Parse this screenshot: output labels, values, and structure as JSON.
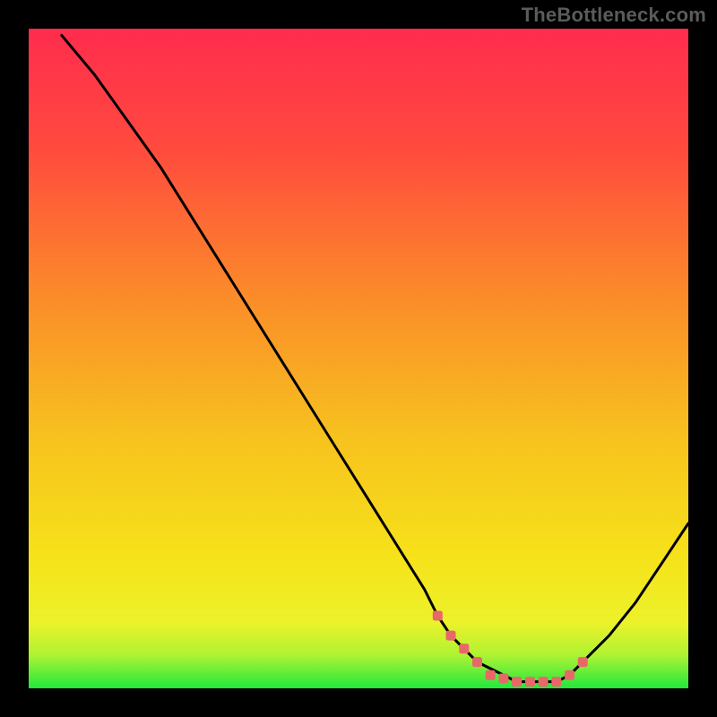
{
  "watermark": "TheBottleneck.com",
  "chart_data": {
    "type": "line",
    "title": "",
    "xlabel": "",
    "ylabel": "",
    "xlim": [
      0,
      100
    ],
    "ylim": [
      0,
      100
    ],
    "grid": false,
    "legend": "none",
    "background_gradient": {
      "top": "#ff2c4e",
      "mid": "#f6cf1d",
      "green_band": "#20e83c",
      "bottom": "#20e83c"
    },
    "series": [
      {
        "name": "bottleneck-curve",
        "type": "line",
        "color": "#000000",
        "x": [
          5,
          10,
          15,
          20,
          25,
          30,
          35,
          40,
          45,
          50,
          55,
          60,
          62,
          64,
          68,
          74,
          80,
          82,
          84,
          88,
          92,
          96,
          100
        ],
        "y": [
          99,
          93,
          86,
          79,
          71,
          63,
          55,
          47,
          39,
          31,
          23,
          15,
          11,
          8,
          4,
          1,
          1,
          2,
          4,
          8,
          13,
          19,
          25
        ]
      },
      {
        "name": "sweet-spot-markers",
        "type": "scatter",
        "color": "#e86868",
        "x": [
          62,
          64,
          66,
          68,
          70,
          72,
          74,
          76,
          78,
          80,
          82,
          84
        ],
        "y": [
          11,
          8,
          6,
          4,
          2,
          1.5,
          1,
          1,
          1,
          1,
          2,
          4
        ]
      }
    ],
    "annotations": []
  }
}
